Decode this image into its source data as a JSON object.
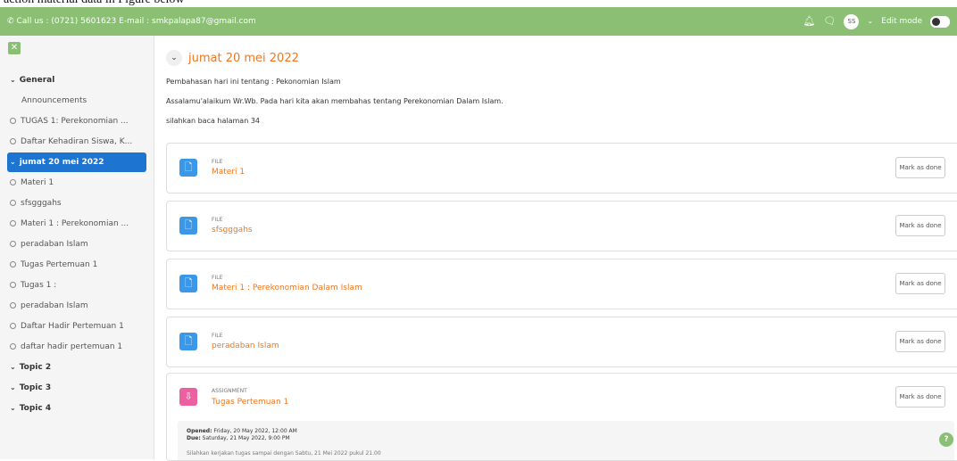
{
  "caption": "action material data in Figure below",
  "navbar": {
    "contact": "Call us : (0721) 5601623  E-mail : smkpalapa87@gmail.com",
    "phone_icon": "phone-icon",
    "mail_icon": "mail-icon",
    "avatar": "SS",
    "edit_mode": "Edit mode",
    "bg_color": "#8abf74"
  },
  "sidebar": {
    "general": "General",
    "items": [
      "Announcements",
      "TUGAS 1: Perekonomian ...",
      "Daftar Kehadiran Siswa, K..."
    ],
    "active_section": "jumat 20 mei 2022",
    "sub_items": [
      "Materi 1",
      "sfsgggahs",
      "Materi 1 : Perekonomian ...",
      "peradaban Islam",
      "Tugas Pertemuan 1",
      "Tugas 1 :",
      "peradaban Islam",
      "Daftar Hadir Pertemuan 1",
      "daftar hadir pertemuan 1"
    ],
    "topics": [
      "Topic 2",
      "Topic 3",
      "Topic 4"
    ]
  },
  "main": {
    "section_title": "jumat 20 mei 2022",
    "desc1": "Pembahasan hari ini tentang : Pekonomian Islam",
    "desc2": "Assalamu'alaikum Wr.Wb. Pada hari kita akan membahas tentang Perekonomian Dalam Islam.",
    "desc3": "silahkan baca halaman 34",
    "activities": [
      {
        "type": "FILE",
        "name": "Materi 1",
        "button": "Mark as done"
      },
      {
        "type": "FILE",
        "name": "sfsgggahs",
        "button": "Mark as done"
      },
      {
        "type": "FILE",
        "name": "Materi 1 : Perekonomian Dalam Islam",
        "button": "Mark as done"
      },
      {
        "type": "FILE",
        "name": "peradaban Islam",
        "button": "Mark as done"
      }
    ],
    "assignment": {
      "type": "ASSIGNMENT",
      "name": "Tugas Pertemuan 1",
      "button": "Mark as done",
      "opened_label": "Opened:",
      "opened_value": "Friday, 20 May 2022, 12:00 AM",
      "due_label": "Due:",
      "due_value": "Saturday, 21 May 2022, 9:00 PM",
      "note": "Silahkan kerjakan tugas sampai dengan Sabtu, 21 Mei 2022 pukul 21.00"
    },
    "help": "?"
  }
}
